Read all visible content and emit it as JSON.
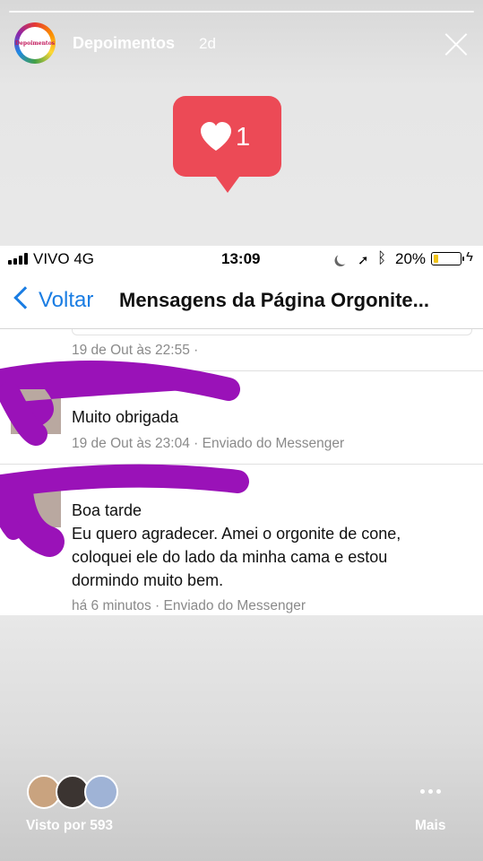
{
  "story": {
    "username": "Depoimentos",
    "time_ago": "2d",
    "avatar_logo_text": "Depoimentos",
    "like_count": "1"
  },
  "screenshot": {
    "status_bar": {
      "carrier": "VIVO   4G",
      "time": "13:09",
      "battery": "20%",
      "battery_level": 0.2
    },
    "nav": {
      "back_label": "Voltar",
      "title": "Mensagens da Página Orgonite..."
    },
    "messages": [
      {
        "lines": [],
        "meta": "19 de Out às 22:55 ·"
      },
      {
        "lines": [
          "Muito obrigada"
        ],
        "meta": "19 de Out às 23:04 · Enviado do Messenger"
      },
      {
        "lines": [
          "Boa tarde",
          "Eu quero agradecer. Amei o orgonite de cone,",
          "coloquei ele do lado da minha cama e estou",
          "dormindo muito bem."
        ],
        "meta": "há 6 minutos · Enviado do Messenger"
      }
    ]
  },
  "footer": {
    "seen_by": "Visto por 593",
    "more_label": "Mais"
  },
  "colors": {
    "like_badge": "#ec4a56",
    "link_blue": "#1a7de3",
    "scribble": "#9a12b8"
  }
}
